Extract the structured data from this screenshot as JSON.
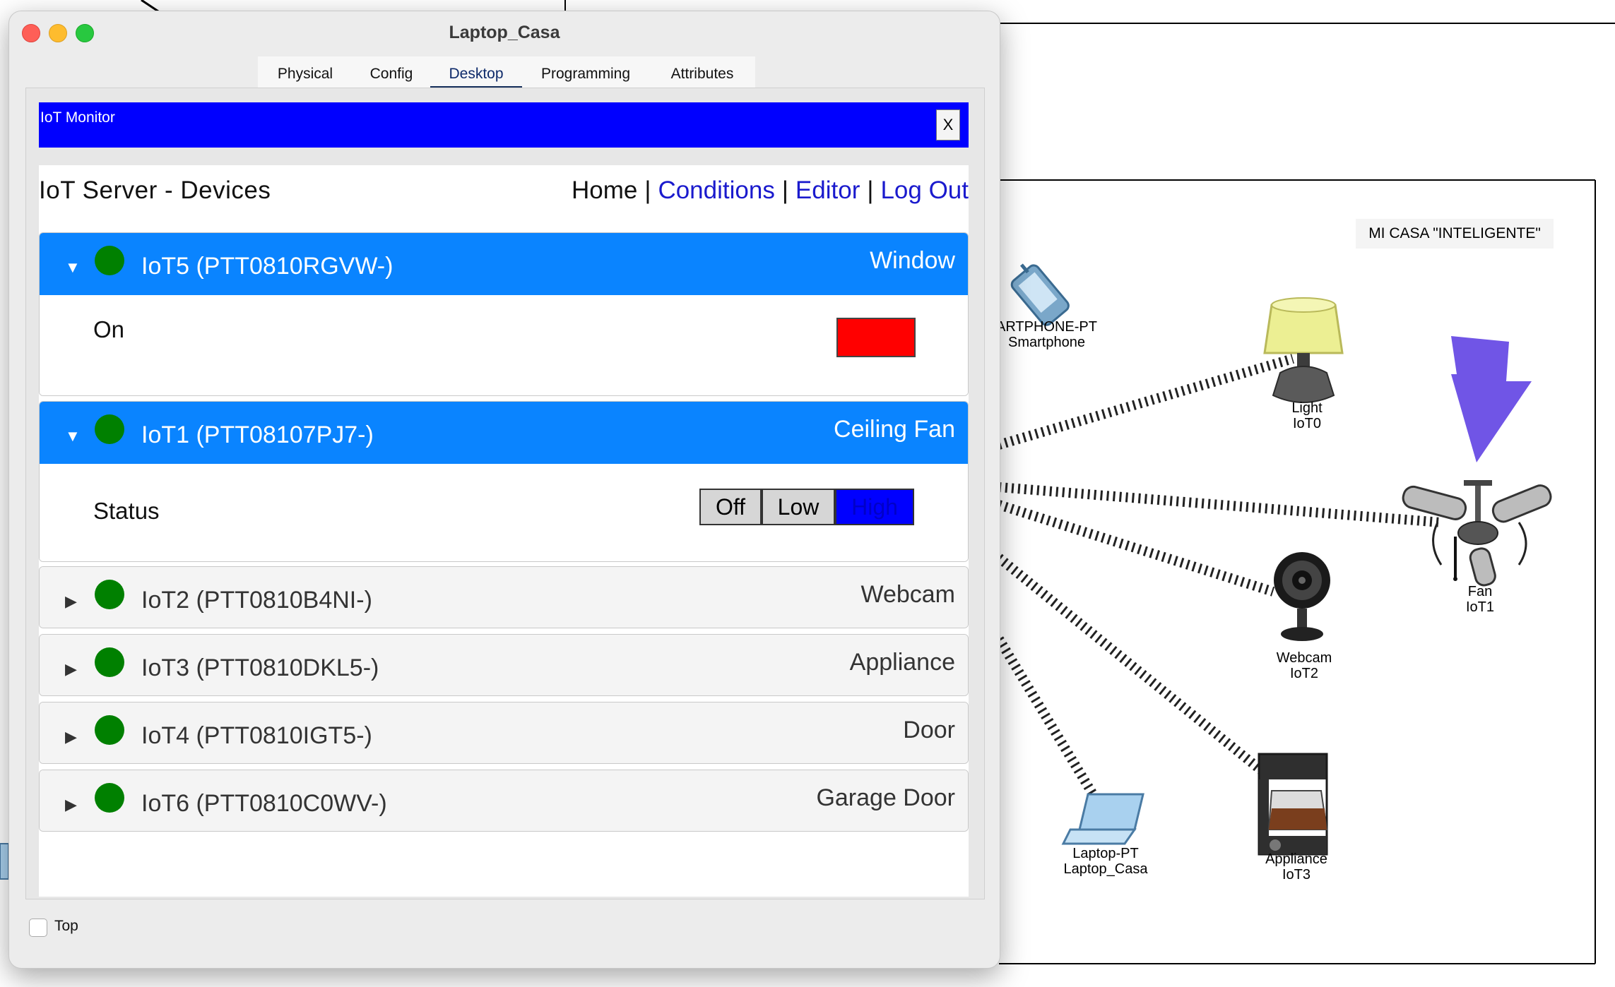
{
  "window": {
    "title": "Laptop_Casa",
    "tabs": [
      "Physical",
      "Config",
      "Desktop",
      "Programming",
      "Attributes"
    ],
    "active_tab": "Desktop",
    "monitor_title": "IoT Monitor",
    "close_label": "X",
    "top_checkbox_label": "Top",
    "top_checked": false
  },
  "server": {
    "title": "IoT Server - Devices",
    "nav": {
      "home": "Home",
      "sep": "|",
      "conditions": "Conditions",
      "editor": "Editor",
      "logout": "Log Out"
    }
  },
  "devices": [
    {
      "name": "IoT5 (PTT0810RGVW-)",
      "type": "Window",
      "expanded": true,
      "status_color": "#008000",
      "property": {
        "label": "On",
        "value_color": "#ff0000"
      }
    },
    {
      "name": "IoT1 (PTT08107PJ7-)",
      "type": "Ceiling Fan",
      "expanded": true,
      "status_color": "#008000",
      "property": {
        "label": "Status",
        "options": [
          "Off",
          "Low",
          "High"
        ],
        "selected": "High"
      }
    },
    {
      "name": "IoT2 (PTT0810B4NI-)",
      "type": "Webcam",
      "expanded": false,
      "status_color": "#008000"
    },
    {
      "name": "IoT3 (PTT0810DKL5-)",
      "type": "Appliance",
      "expanded": false,
      "status_color": "#008000"
    },
    {
      "name": "IoT4 (PTT0810IGT5-)",
      "type": "Door",
      "expanded": false,
      "status_color": "#008000"
    },
    {
      "name": "IoT6 (PTT0810C0WV-)",
      "type": "Garage Door",
      "expanded": false,
      "status_color": "#008000"
    }
  ],
  "topology": {
    "title_label": "MI CASA \"INTELIGENTE\"",
    "devices": [
      {
        "line1": "ARTPHONE-PT",
        "line2": "Smartphone",
        "icon": "smartphone-icon"
      },
      {
        "line1": "Light",
        "line2": "IoT0",
        "icon": "lamp-icon"
      },
      {
        "line1": "Fan",
        "line2": "IoT1",
        "icon": "ceiling-fan-icon"
      },
      {
        "line1": "Webcam",
        "line2": "IoT2",
        "icon": "webcam-icon"
      },
      {
        "line1": "Laptop-PT",
        "line2": "Laptop_Casa",
        "icon": "laptop-icon"
      },
      {
        "line1": "Appliance",
        "line2": "IoT3",
        "icon": "coffee-maker-icon"
      }
    ]
  },
  "colors": {
    "accent_blue": "#0a84ff",
    "monitor_bar": "#0000ff",
    "status_green": "#008000",
    "annotation_yellow": "#f7dc4a",
    "annotation_purple": "#7055e6"
  }
}
